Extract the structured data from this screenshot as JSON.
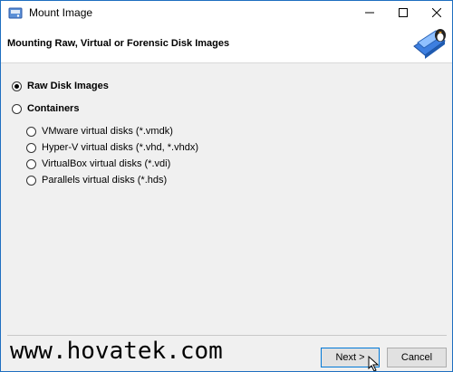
{
  "window": {
    "title": "Mount Image",
    "controls": {
      "minimize": "minimize",
      "maximize": "maximize",
      "close": "close"
    }
  },
  "header": {
    "title": "Mounting Raw, Virtual or Forensic Disk Images"
  },
  "options": {
    "raw": {
      "label": "Raw Disk Images",
      "selected": true
    },
    "containers": {
      "label": "Containers",
      "selected": false
    },
    "container_types": [
      {
        "label": "VMware virtual disks (*.vmdk)",
        "selected": false
      },
      {
        "label": "Hyper-V virtual disks (*.vhd, *.vhdx)",
        "selected": false
      },
      {
        "label": "VirtualBox virtual disks (*.vdi)",
        "selected": false
      },
      {
        "label": "Parallels virtual disks (*.hds)",
        "selected": false
      }
    ]
  },
  "footer": {
    "watermark": "www.hovatek.com",
    "next_label": "Next >",
    "cancel_label": "Cancel"
  },
  "colors": {
    "accent": "#0078d7",
    "window_border": "#1e6fc0",
    "dialog_bg": "#f0f0f0"
  },
  "icons": [
    "app-icon",
    "disk-logo-icon",
    "minimize-icon",
    "maximize-icon",
    "close-icon",
    "mouse-cursor-icon"
  ]
}
